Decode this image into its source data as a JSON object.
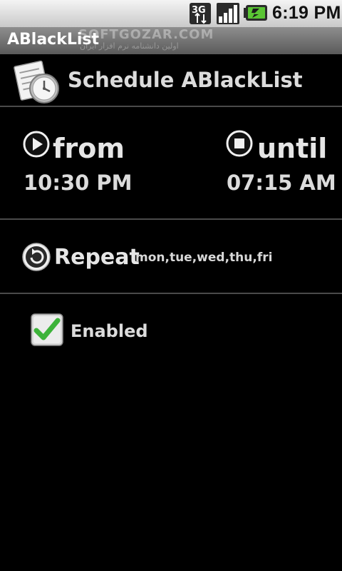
{
  "status_bar": {
    "network_label": "3G",
    "time": "6:19 PM",
    "icons": [
      "3g-data-icon",
      "signal-strength-icon",
      "battery-charging-icon"
    ]
  },
  "app_bar": {
    "title": "ABlackList",
    "watermark": "SOFTGOZAR.COM",
    "watermark_sub": "اولین دانشنامه نرم افزار ایران"
  },
  "header": {
    "title": "Schedule ABlackList",
    "icon": "schedule-clock-icon"
  },
  "schedule": {
    "from": {
      "label": "from",
      "time": "10:30 PM",
      "icon": "play-icon"
    },
    "until": {
      "label": "until",
      "time": "07:15 AM",
      "icon": "stop-icon"
    }
  },
  "repeat": {
    "label": "Repeat",
    "days": "mon,tue,wed,thu,fri",
    "icon": "repeat-icon"
  },
  "enabled": {
    "label": "Enabled",
    "checked": true
  },
  "colors": {
    "background": "#000000",
    "text": "#e6e6e6",
    "divider": "#4a4a4a",
    "check_green": "#3db33a"
  }
}
